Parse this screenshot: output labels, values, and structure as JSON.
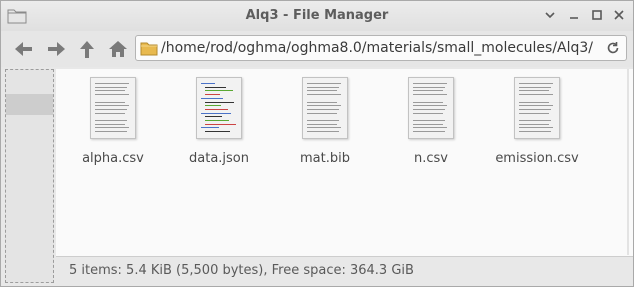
{
  "window": {
    "title": "Alq3 - File Manager"
  },
  "window_controls": {
    "minimize": "⌄",
    "restore": "_",
    "maximize": "□",
    "close": "✕"
  },
  "toolbar": {
    "back_icon": "arrow-left-icon",
    "forward_icon": "arrow-right-icon",
    "up_icon": "arrow-up-icon",
    "home_icon": "home-icon"
  },
  "location": {
    "path": "/home/rod/oghma/oghma8.0/materials/small_molecules/Alq3/",
    "reload_icon": "reload-icon"
  },
  "files": [
    {
      "name": "alpha.csv",
      "kind": "text"
    },
    {
      "name": "data.json",
      "kind": "code"
    },
    {
      "name": "mat.bib",
      "kind": "text"
    },
    {
      "name": "n.csv",
      "kind": "text"
    },
    {
      "name": "emission.csv",
      "kind": "text"
    }
  ],
  "status": {
    "text": "5 items: 5.4 KiB (5,500 bytes), Free space: 364.3 GiB"
  },
  "colors": {
    "folder": "#d9a441",
    "accent_green": "#5aa832",
    "accent_red": "#cc4444",
    "accent_blue": "#4a72c8"
  }
}
